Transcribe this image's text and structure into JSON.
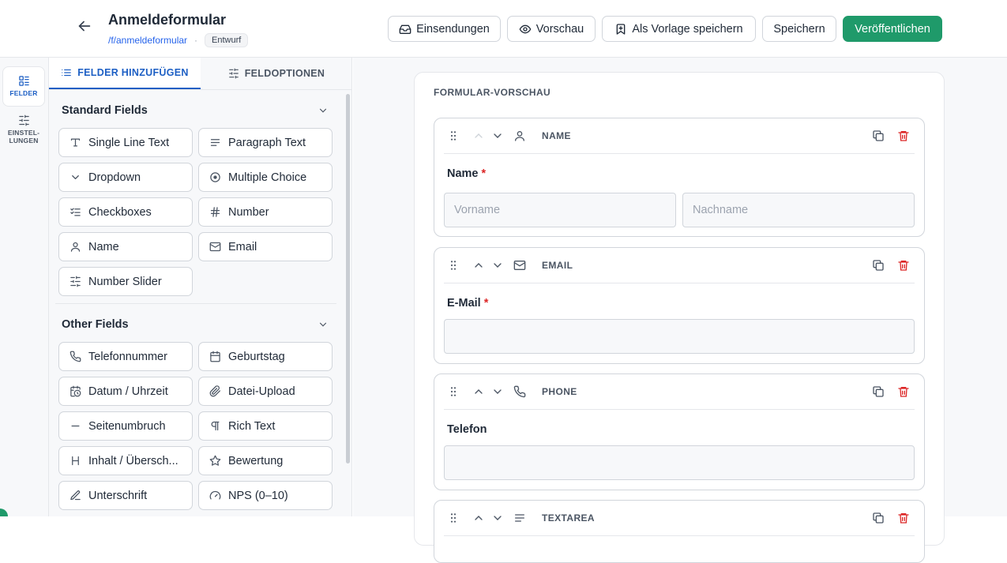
{
  "header": {
    "title": "Anmeldeformular",
    "slug": "/f/anmeldeformular",
    "separator": "·",
    "status_badge": "Entwurf",
    "buttons": {
      "submissions": "Einsendungen",
      "preview": "Vorschau",
      "save_template": "Als Vorlage speichern",
      "save": "Speichern",
      "publish": "Veröffentlichen"
    }
  },
  "rail": {
    "fields": "FELDER",
    "settings_line1": "EINSTEL-",
    "settings_line2": "LUNGEN"
  },
  "panel": {
    "tabs": {
      "add_fields": "FELDER HINZUFÜGEN",
      "field_options": "FELDOPTIONEN"
    },
    "standard": {
      "heading": "Standard Fields",
      "items": [
        {
          "label": "Single Line Text",
          "icon": "text-icon"
        },
        {
          "label": "Paragraph Text",
          "icon": "paragraph-lines-icon"
        },
        {
          "label": "Dropdown",
          "icon": "chevron-down-icon"
        },
        {
          "label": "Multiple Choice",
          "icon": "radio-icon"
        },
        {
          "label": "Checkboxes",
          "icon": "checklist-icon"
        },
        {
          "label": "Number",
          "icon": "hash-icon"
        },
        {
          "label": "Name",
          "icon": "user-icon"
        },
        {
          "label": "Email",
          "icon": "mail-icon"
        },
        {
          "label": "Number Slider",
          "icon": "sliders-icon"
        }
      ]
    },
    "other": {
      "heading": "Other Fields",
      "items": [
        {
          "label": "Telefonnummer",
          "icon": "phone-icon"
        },
        {
          "label": "Geburtstag",
          "icon": "calendar-icon"
        },
        {
          "label": "Datum / Uhrzeit",
          "icon": "calendar-clock-icon"
        },
        {
          "label": "Datei-Upload",
          "icon": "paperclip-icon"
        },
        {
          "label": "Seitenumbruch",
          "icon": "minus-icon"
        },
        {
          "label": "Rich Text",
          "icon": "pilcrow-icon"
        },
        {
          "label": "Inhalt / Übersch...",
          "icon": "heading-icon"
        },
        {
          "label": "Bewertung",
          "icon": "star-icon"
        },
        {
          "label": "Unterschrift",
          "icon": "pen-icon"
        },
        {
          "label": "NPS (0–10)",
          "icon": "gauge-icon"
        }
      ]
    }
  },
  "preview": {
    "title": "FORMULAR-VORSCHAU",
    "fields": [
      {
        "type": "NAME",
        "label": "Name",
        "required": "*",
        "placeholder_first": "Vorname",
        "placeholder_last": "Nachname",
        "icon": "user-icon"
      },
      {
        "type": "EMAIL",
        "label": "E-Mail",
        "required": "*",
        "icon": "mail-icon"
      },
      {
        "type": "PHONE",
        "label": "Telefon",
        "icon": "phone-icon"
      },
      {
        "type": "TEXTAREA",
        "icon": "paragraph-lines-icon"
      }
    ]
  },
  "colors": {
    "primary": "#1f9a6a",
    "accent": "#1d5fc4",
    "danger": "#dc2626",
    "link": "#2563eb"
  }
}
